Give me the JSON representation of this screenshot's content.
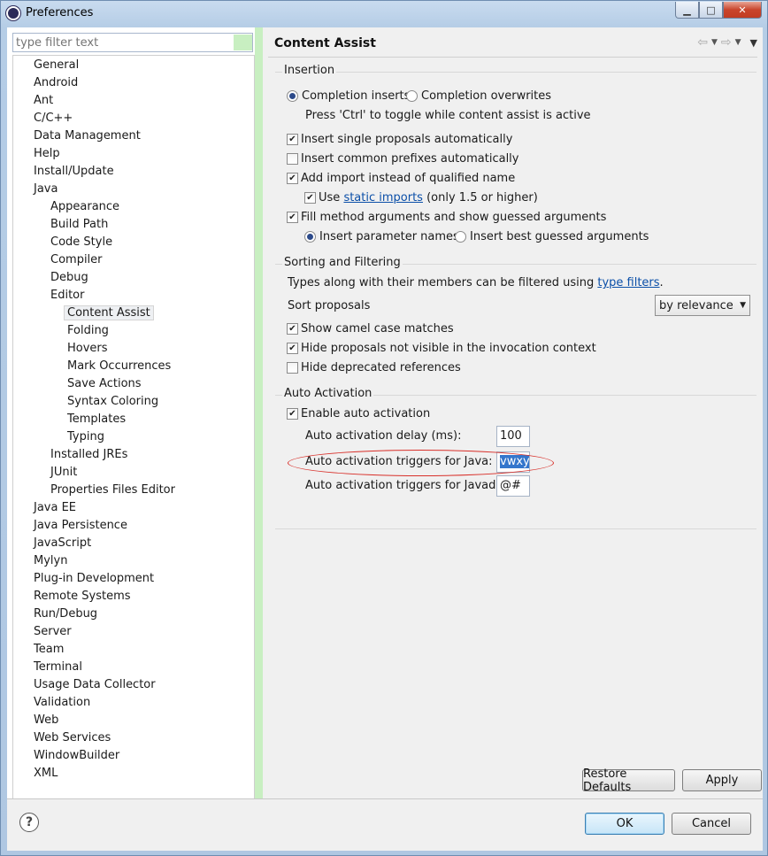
{
  "window": {
    "title": "Preferences",
    "minimize": "▁",
    "maximize": "□",
    "close": "✕"
  },
  "filter": {
    "placeholder": "type filter text"
  },
  "tree": [
    {
      "label": "General",
      "level": 0
    },
    {
      "label": "Android",
      "level": 0
    },
    {
      "label": "Ant",
      "level": 0
    },
    {
      "label": "C/C++",
      "level": 0
    },
    {
      "label": "Data Management",
      "level": 0
    },
    {
      "label": "Help",
      "level": 0
    },
    {
      "label": "Install/Update",
      "level": 0
    },
    {
      "label": "Java",
      "level": 0
    },
    {
      "label": "Appearance",
      "level": 1
    },
    {
      "label": "Build Path",
      "level": 1
    },
    {
      "label": "Code Style",
      "level": 1
    },
    {
      "label": "Compiler",
      "level": 1
    },
    {
      "label": "Debug",
      "level": 1
    },
    {
      "label": "Editor",
      "level": 1
    },
    {
      "label": "Content Assist",
      "level": 2,
      "selected": true
    },
    {
      "label": "Folding",
      "level": 2
    },
    {
      "label": "Hovers",
      "level": 2
    },
    {
      "label": "Mark Occurrences",
      "level": 2
    },
    {
      "label": "Save Actions",
      "level": 2
    },
    {
      "label": "Syntax Coloring",
      "level": 2
    },
    {
      "label": "Templates",
      "level": 2
    },
    {
      "label": "Typing",
      "level": 2
    },
    {
      "label": "Installed JREs",
      "level": 1
    },
    {
      "label": "JUnit",
      "level": 1
    },
    {
      "label": "Properties Files Editor",
      "level": 1
    },
    {
      "label": "Java EE",
      "level": 0
    },
    {
      "label": "Java Persistence",
      "level": 0
    },
    {
      "label": "JavaScript",
      "level": 0
    },
    {
      "label": "Mylyn",
      "level": 0
    },
    {
      "label": "Plug-in Development",
      "level": 0
    },
    {
      "label": "Remote Systems",
      "level": 0
    },
    {
      "label": "Run/Debug",
      "level": 0
    },
    {
      "label": "Server",
      "level": 0
    },
    {
      "label": "Team",
      "level": 0
    },
    {
      "label": "Terminal",
      "level": 0
    },
    {
      "label": "Usage Data Collector",
      "level": 0
    },
    {
      "label": "Validation",
      "level": 0
    },
    {
      "label": "Web",
      "level": 0
    },
    {
      "label": "Web Services",
      "level": 0
    },
    {
      "label": "WindowBuilder",
      "level": 0
    },
    {
      "label": "XML",
      "level": 0
    }
  ],
  "page": {
    "title": "Content Assist",
    "nav_back": "⇦",
    "nav_forward": "⇨",
    "nav_dropdown": "▼",
    "nav_menu": "▼"
  },
  "insertion": {
    "title": "Insertion",
    "completion_inserts": "Completion inserts",
    "completion_overwrites": "Completion overwrites",
    "toggle_hint": "Press 'Ctrl' to toggle while content assist is active",
    "insert_single": "Insert single proposals automatically",
    "insert_common": "Insert common prefixes automatically",
    "add_import": "Add import instead of qualified name",
    "use_prefix": "Use",
    "static_imports": "static imports",
    "use_suffix": "(only 1.5 or higher)",
    "fill_method": "Fill method arguments and show guessed arguments",
    "insert_param_names": "Insert parameter names",
    "insert_best_guessed": "Insert best guessed arguments"
  },
  "sorting": {
    "title": "Sorting and Filtering",
    "types_text": "Types along with their members can be filtered using",
    "type_filters": "type filters",
    "period": ".",
    "sort_label": "Sort proposals",
    "sort_value": "by relevance",
    "show_camel": "Show camel case matches",
    "hide_not_visible": "Hide proposals not visible in the invocation context",
    "hide_deprecated": "Hide deprecated references"
  },
  "auto": {
    "title": "Auto Activation",
    "enable": "Enable auto activation",
    "delay_label": "Auto activation delay (ms):",
    "delay_value": "100",
    "java_label": "Auto activation triggers for Java:",
    "java_value": "vwxyz",
    "javadoc_label": "Auto activation triggers for Javadoc:",
    "javadoc_value": "@#"
  },
  "buttons": {
    "restore_defaults": "Restore Defaults",
    "apply": "Apply",
    "ok": "OK",
    "cancel": "Cancel",
    "help": "?"
  },
  "checks": {
    "completion_inserts": true,
    "insert_single": true,
    "insert_common": false,
    "add_import": true,
    "use_static": true,
    "fill_method": true,
    "insert_param_names": true,
    "show_camel": true,
    "hide_not_visible": true,
    "hide_deprecated": false,
    "enable_auto": true
  }
}
